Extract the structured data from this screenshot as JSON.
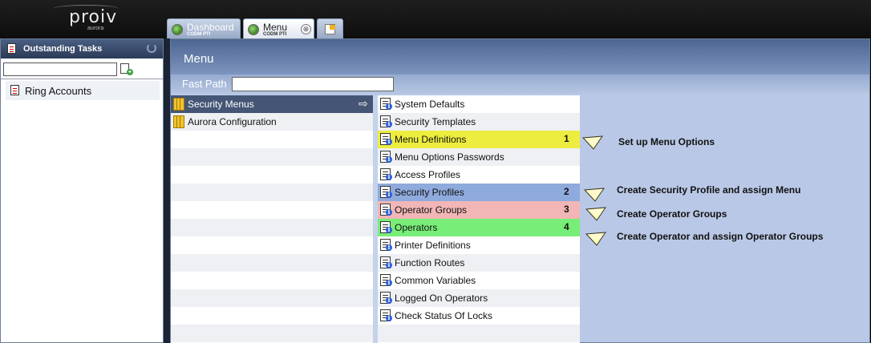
{
  "app": {
    "logo_main": "proiv",
    "logo_sub": "aurora"
  },
  "tabs": [
    {
      "title": "Dashboard",
      "subtitle": "CODM PTI"
    },
    {
      "title": "Menu",
      "subtitle": "CODM PTI",
      "close": "⊗"
    }
  ],
  "tasks": {
    "title": "Outstanding Tasks",
    "search_value": "",
    "items": [
      "Ring Accounts"
    ]
  },
  "menu": {
    "title": "Menu",
    "fast_path_label": "Fast Path",
    "fast_path_value": "",
    "folders": [
      "Security Menus",
      "Aurora Configuration"
    ],
    "selected_arrow": "⇨",
    "options": [
      {
        "label": "System Defaults",
        "step": ""
      },
      {
        "label": "Security Templates",
        "step": ""
      },
      {
        "label": "Menu Definitions",
        "step": "1"
      },
      {
        "label": "Menu Options Passwords",
        "step": ""
      },
      {
        "label": "Access Profiles",
        "step": ""
      },
      {
        "label": "Security Profiles",
        "step": "2"
      },
      {
        "label": "Operator Groups",
        "step": "3"
      },
      {
        "label": "Operators",
        "step": "4"
      },
      {
        "label": "Printer Definitions",
        "step": ""
      },
      {
        "label": "Function Routes",
        "step": ""
      },
      {
        "label": "Common Variables",
        "step": ""
      },
      {
        "label": "Logged On Operators",
        "step": ""
      },
      {
        "label": "Check Status Of Locks",
        "step": ""
      }
    ]
  },
  "annotations": [
    "Set up Menu Options",
    "Create Security Profile and assign Menu",
    "Create Operator Groups",
    "Create Operator and assign Operator Groups"
  ],
  "colors": {
    "highlight_1": "#eded3f",
    "highlight_2": "#8faadc",
    "highlight_3": "#f2b6b6",
    "highlight_4": "#78ee78",
    "callout_fill": "#ffff99"
  }
}
